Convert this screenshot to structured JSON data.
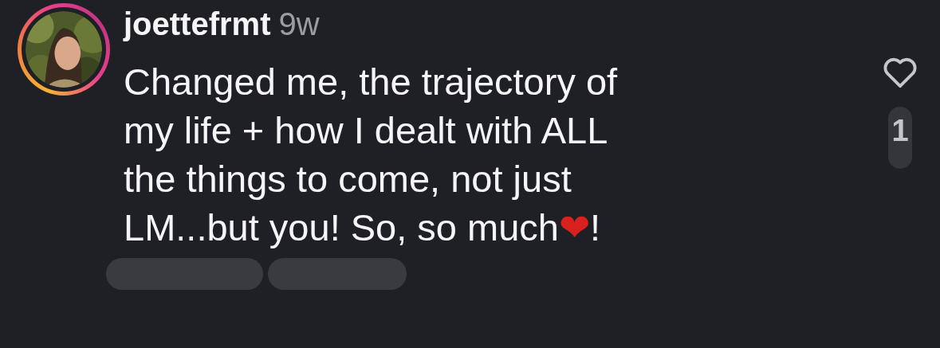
{
  "comment": {
    "username": "joettefrmt",
    "time": "9w",
    "lines": [
      [
        {
          "kind": "text",
          "text": "Changed me, the trajectory of"
        }
      ],
      [
        {
          "kind": "text",
          "text": "my life + how I dealt with ALL"
        }
      ],
      [
        {
          "kind": "text",
          "text": "the things to come, not just"
        }
      ],
      [
        {
          "kind": "text",
          "text": "LM...but you! So, so much"
        },
        {
          "kind": "emoji",
          "text": "❤"
        },
        {
          "kind": "text",
          "text": "!"
        }
      ]
    ],
    "avatar": {
      "kind": "picture",
      "story_ring": true
    },
    "like": {
      "liked": false,
      "count": "1"
    }
  }
}
